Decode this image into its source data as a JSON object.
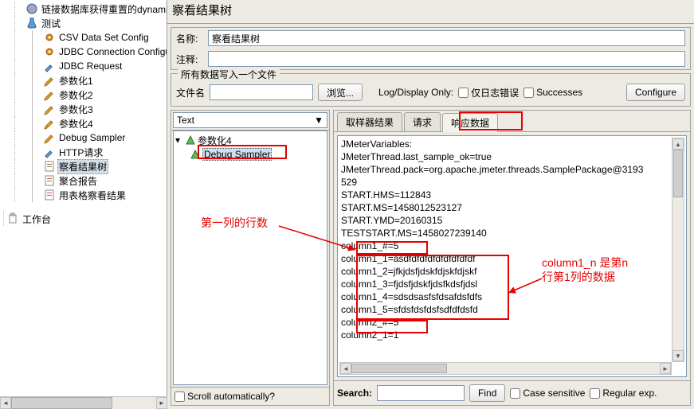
{
  "title": "察看结果树",
  "props": {
    "name_label": "名称:",
    "name_value": "察看结果树",
    "comment_label": "注释:",
    "comment_value": ""
  },
  "file_group": {
    "legend": "所有数据写入一个文件",
    "filename_label": "文件名",
    "filename_value": "",
    "browse_btn": "浏览...",
    "logonly_label": "Log/Display Only:",
    "errors_label": "仅日志错误",
    "successes_label": "Successes",
    "configure_btn": "Configure"
  },
  "tree": {
    "items": [
      {
        "label": "链接数据库获得重置的dynamic",
        "indent": 1,
        "icon": "disk"
      },
      {
        "label": "测试",
        "indent": 1,
        "icon": "flask"
      },
      {
        "label": "CSV Data Set Config",
        "indent": 2,
        "icon": "gear"
      },
      {
        "label": "JDBC Connection Configurat",
        "indent": 2,
        "icon": "gear"
      },
      {
        "label": "JDBC Request",
        "indent": 2,
        "icon": "dropper"
      },
      {
        "label": "参数化1",
        "indent": 2,
        "icon": "pencil"
      },
      {
        "label": "参数化2",
        "indent": 2,
        "icon": "pencil"
      },
      {
        "label": "参数化3",
        "indent": 2,
        "icon": "pencil"
      },
      {
        "label": "参数化4",
        "indent": 2,
        "icon": "pencil"
      },
      {
        "label": "Debug Sampler",
        "indent": 2,
        "icon": "pencil"
      },
      {
        "label": "HTTP请求",
        "indent": 2,
        "icon": "dropper"
      },
      {
        "label": "察看结果树",
        "indent": 2,
        "icon": "paper",
        "selected": true
      },
      {
        "label": "聚合报告",
        "indent": 2,
        "icon": "paper"
      },
      {
        "label": "用表格察看结果",
        "indent": 2,
        "icon": "paper"
      }
    ],
    "workbench": "工作台"
  },
  "left_panel": {
    "dropdown": "Text",
    "sampler_root": "参数化4",
    "sampler_child": "Debug Sampler",
    "scroll_auto_label": "Scroll automatically?"
  },
  "tabs": {
    "sampler_result": "取样器结果",
    "request": "请求",
    "response_data": "响应数据"
  },
  "response_lines": [
    "JMeterVariables:",
    "JMeterThread.last_sample_ok=true",
    "JMeterThread.pack=org.apache.jmeter.threads.SamplePackage@3193",
    "529",
    "START.HMS=112843",
    "START.MS=1458012523127",
    "START.YMD=20160315",
    "TESTSTART.MS=1458027239140",
    "column1_#=5",
    "column1_1=asdfdfdfdfdfdfdfdfdf",
    "column1_2=jfkjdsfjdskfdjskfdjskf",
    "column1_3=fjdsfjdskfjdsfkdsfjdsl",
    "column1_4=sdsdsasfsfdsafdsfdfs",
    "column1_5=sfdsfdsfdsfsdfdfdsfd",
    "column2_#=5",
    "column2_1=1"
  ],
  "search": {
    "label": "Search:",
    "value": "",
    "find_btn": "Find",
    "case_label": "Case sensitive",
    "regex_label": "Regular exp."
  },
  "annotations": {
    "rows_text": "第一列的行数",
    "colnote_1": "column1_n 是第n",
    "colnote_2": "行第1列的数据"
  }
}
